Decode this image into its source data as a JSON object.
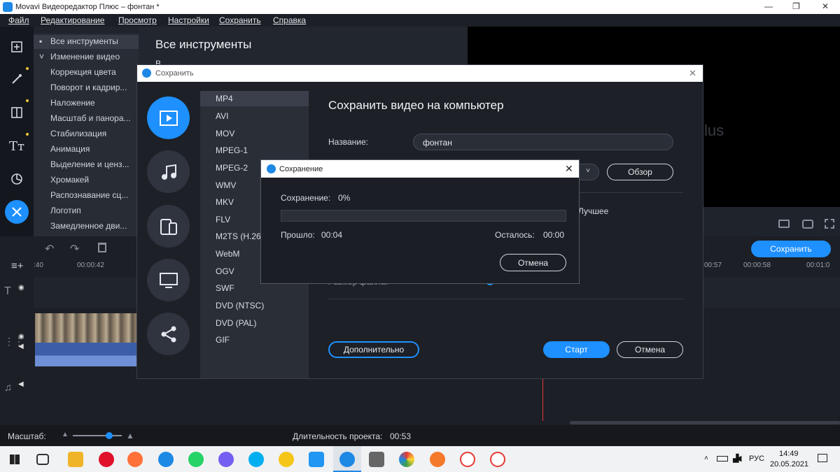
{
  "window": {
    "title": "Movavi Видеоредактор Плюс – фонтан *"
  },
  "menu": [
    "Файл",
    "Редактирование",
    "Просмотр",
    "Настройки",
    "Сохранить",
    "Справка"
  ],
  "tools": {
    "header": "Все инструменты",
    "group": "Изменение видео",
    "items": [
      "Коррекция цвета",
      "Поворот и кадрир...",
      "Наложение",
      "Масштаб и панора...",
      "Стабилизация",
      "Анимация",
      "Выделение и ценз...",
      "Хромакей",
      "Распознавание сц...",
      "Логотип",
      "Замедленное дви..."
    ]
  },
  "main": {
    "title": "Все инструменты",
    "partial_text": "В"
  },
  "preview": {
    "watermark": "lus"
  },
  "timeline": {
    "ruler_left": [
      ":40",
      "00:00:42"
    ],
    "ruler_right": [
      "00:57",
      "00:00:58",
      "00:01:0"
    ],
    "save_button": "Сохранить"
  },
  "status": {
    "scale_label": "Масштаб:",
    "duration_label": "Длительность проекта:",
    "duration": "00:53"
  },
  "save_dialog": {
    "title": "Сохранить",
    "heading": "Сохранить видео на компьютер",
    "name_label": "Название:",
    "name_value": "фонтан",
    "browse": "Обзор",
    "quality_partial": "Лучшее",
    "filesize_partial": "Размер файла:",
    "advanced": "Дополнительно",
    "start": "Старт",
    "cancel": "Отмена",
    "formats": [
      "MP4",
      "AVI",
      "MOV",
      "MPEG-1",
      "MPEG-2",
      "WMV",
      "MKV",
      "FLV",
      "M2TS (H.264)",
      "WebM",
      "OGV",
      "SWF",
      "DVD (NTSC)",
      "DVD (PAL)",
      "GIF"
    ],
    "selected_format": "MP4"
  },
  "progress_dialog": {
    "title": "Сохранение",
    "status_label": "Сохранение:",
    "percent": "0%",
    "percent_value": 0,
    "elapsed_label": "Прошло:",
    "elapsed": "00:04",
    "remaining_label": "Осталось:",
    "remaining": "00:00",
    "cancel": "Отмена"
  },
  "taskbar": {
    "lang": "РУС",
    "time": "14:49",
    "date": "20.05.2021"
  },
  "colors": {
    "accent": "#1e90ff",
    "dialog_bg": "#1d2027",
    "panel": "#2a2e37"
  }
}
